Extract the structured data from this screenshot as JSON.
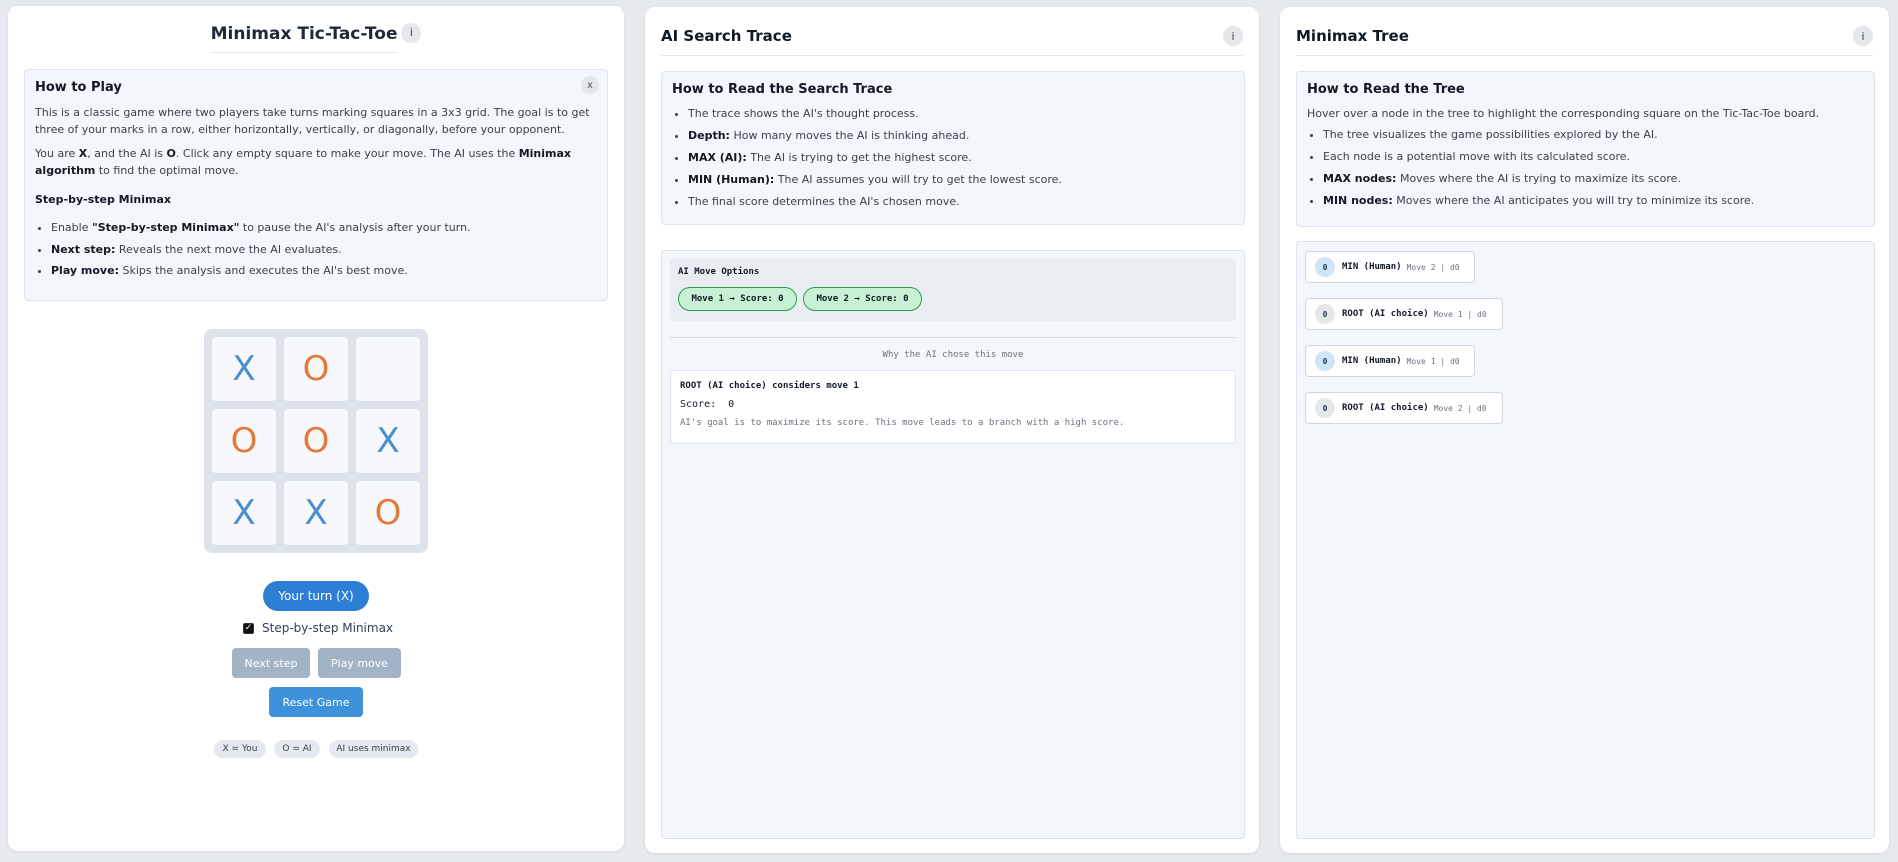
{
  "game_panel": {
    "title": "Minimax Tic-Tac-Toe",
    "info_label": "i",
    "how_to": {
      "close_label": "x",
      "heading": "How to Play",
      "para1": "This is a classic game where two players take turns marking squares in a 3x3 grid. The goal is to get three of your marks in a row, either horizontally, vertically, or diagonally, before your opponent.",
      "para2_a": "You are ",
      "para2_x": "X",
      "para2_b": ", and the AI is ",
      "para2_o": "O",
      "para2_c": ". Click any empty square to make your move. The AI uses the ",
      "para2_algo": "Minimax algorithm",
      "para2_d": " to find the optimal move.",
      "subheading": "Step-by-step Minimax",
      "items": [
        {
          "pre": "Enable ",
          "bold": "\"Step-by-step Minimax\"",
          "post": " to pause the AI's analysis after your turn."
        },
        {
          "pre": "",
          "bold": "Next step:",
          "post": " Reveals the next move the AI evaluates."
        },
        {
          "pre": "",
          "bold": "Play move:",
          "post": " Skips the analysis and executes the AI's best move."
        }
      ]
    },
    "board": [
      "X",
      "O",
      "",
      "O",
      "O",
      "X",
      "X",
      "X",
      "O"
    ],
    "turn_label": "Your turn (X)",
    "step_checkbox_label": "Step-by-step Minimax",
    "step_checked": true,
    "next_step_label": "Next step",
    "play_move_label": "Play move",
    "reset_label": "Reset Game",
    "chips": [
      "X = You",
      "O = AI",
      "AI uses minimax"
    ]
  },
  "trace_panel": {
    "title": "AI Search Trace",
    "info_label": "i",
    "how_to": {
      "heading": "How to Read the Search Trace",
      "items": [
        {
          "bold": "",
          "post": "The trace shows the AI's thought process."
        },
        {
          "bold": "Depth:",
          "post": " How many moves the AI is thinking ahead."
        },
        {
          "bold": "MAX (AI):",
          "post": " The AI is trying to get the highest score."
        },
        {
          "bold": "MIN (Human):",
          "post": " The AI assumes you will try to get the lowest score."
        },
        {
          "bold": "",
          "post": "The final score determines the AI's chosen move."
        }
      ]
    },
    "options_label": "AI Move Options",
    "options": [
      "Move 1 → Score: 0",
      "Move 2 → Score: 0"
    ],
    "why_label": "Why the AI chose this move",
    "explanation": {
      "line1": "ROOT (AI choice) considers move 1",
      "score_label": "Score:",
      "score_value": "0",
      "line3": "AI's goal is to maximize its score. This move leads to a branch with a high score."
    }
  },
  "tree_panel": {
    "title": "Minimax Tree",
    "info_label": "i",
    "how_to": {
      "heading": "How to Read the Tree",
      "intro": "Hover over a node in the tree to highlight the corresponding square on the Tic-Tac-Toe board.",
      "items": [
        {
          "bold": "",
          "post": "The tree visualizes the game possibilities explored by the AI."
        },
        {
          "bold": "",
          "post": "Each node is a potential move with its calculated score."
        },
        {
          "bold": "MAX nodes:",
          "post": " Moves where the AI is trying to maximize its score."
        },
        {
          "bold": "MIN nodes:",
          "post": " Moves where the AI anticipates you will try to minimize its score."
        }
      ]
    },
    "nodes": [
      {
        "score": "0",
        "label": "MIN (Human)",
        "meta": "Move 2 | d0"
      },
      {
        "score": "0",
        "label": "ROOT (AI choice)",
        "meta": "Move 1 | d0"
      },
      {
        "score": "0",
        "label": "MIN (Human)",
        "meta": "Move 1 | d0"
      },
      {
        "score": "0",
        "label": "ROOT (AI choice)",
        "meta": "Move 2 | d0"
      }
    ]
  }
}
